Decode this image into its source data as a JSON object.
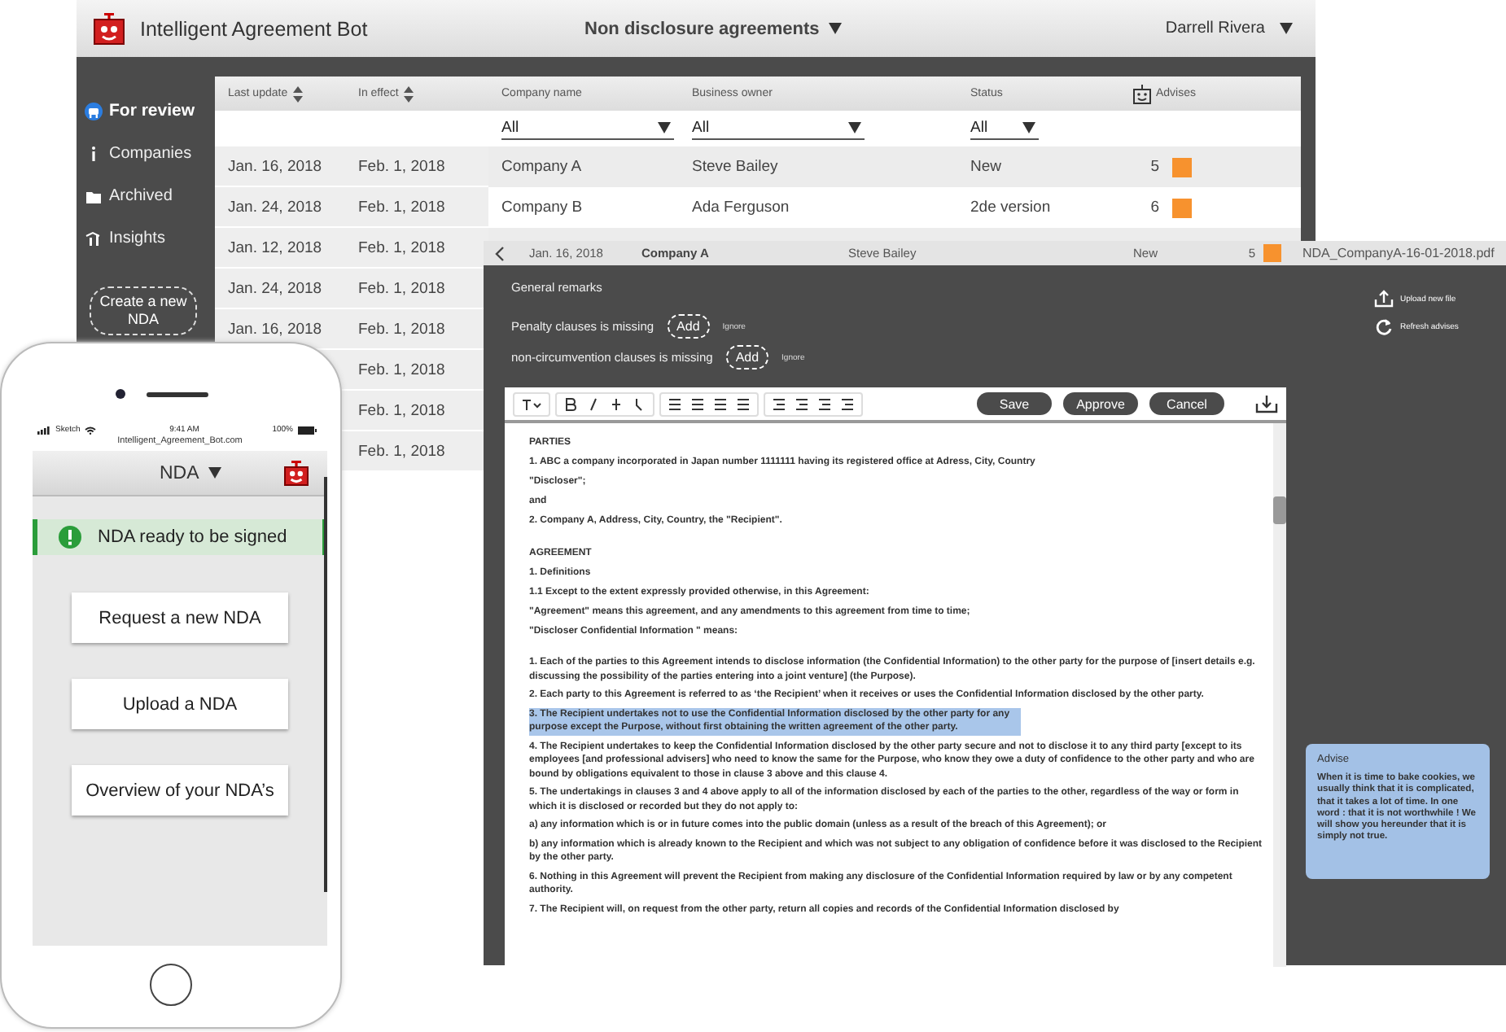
{
  "app": {
    "title": "Intelligent Agreement Bot",
    "section": "Non disclosure agreements",
    "user": "Darrell Rivera"
  },
  "sidebar": {
    "items": [
      {
        "label": "For review",
        "selected": true,
        "kind": "review"
      },
      {
        "label": "Companies",
        "selected": false,
        "kind": "companies"
      },
      {
        "label": "Archived",
        "selected": false,
        "kind": "archived"
      },
      {
        "label": "Insights",
        "selected": false,
        "kind": "insights"
      }
    ],
    "create_button": "Create a new NDA"
  },
  "table": {
    "columns": [
      {
        "label": "Last update",
        "sortable": true
      },
      {
        "label": "In effect",
        "sortable": true
      },
      {
        "label": "Company name",
        "sortable": false,
        "filter": "All"
      },
      {
        "label": "Business owner",
        "sortable": false,
        "filter": "All"
      },
      {
        "label": "Status",
        "sortable": false,
        "filter": "All"
      },
      {
        "label": "Advises",
        "sortable": false
      }
    ],
    "rows": [
      {
        "last_update": "Jan. 16, 2018",
        "in_effect": "Feb. 1, 2018",
        "company": "Company A",
        "owner": "Steve Bailey",
        "status": "New",
        "advises": "5"
      },
      {
        "last_update": "Jan. 24, 2018",
        "in_effect": "Feb. 1, 2018",
        "company": "Company B",
        "owner": "Ada Ferguson",
        "status": "2de version",
        "advises": "6"
      },
      {
        "last_update": "Jan. 12, 2018",
        "in_effect": "Feb. 1, 2018"
      },
      {
        "last_update": "Jan. 24, 2018",
        "in_effect": "Feb. 1, 2018"
      },
      {
        "last_update": "Jan. 16, 2018",
        "in_effect": "Feb. 1, 2018"
      },
      {
        "in_effect": "Feb. 1, 2018"
      },
      {
        "in_effect": "Feb. 1, 2018"
      },
      {
        "in_effect": "Feb. 1, 2018"
      }
    ]
  },
  "document": {
    "header": {
      "date": "Jan. 16, 2018",
      "company": "Company A",
      "owner": "Steve Bailey",
      "status": "New",
      "advises": "5",
      "file": "NDA_CompanyA-16-01-2018.pdf"
    },
    "remarks_title": "General remarks",
    "remarks": [
      {
        "text": "Penalty clauses is missing",
        "action": "Add",
        "dismiss": "Ignore"
      },
      {
        "text": "non-circumvention clauses is missing",
        "action": "Add",
        "dismiss": "Ignore"
      }
    ],
    "side_actions": [
      {
        "label": "Upload new file",
        "kind": "upload"
      },
      {
        "label": "Refresh advises",
        "kind": "refresh"
      }
    ],
    "buttons": [
      "Save",
      "Approve",
      "Cancel"
    ],
    "sections": [
      {
        "paragraphs": [
          {
            "text": "PARTIES",
            "highlighted": false
          },
          {
            "text": "1. ABC a company incorporated in Japan number 1111111 having its registered office at Adress, City, Country",
            "highlighted": false
          },
          {
            "text": "\"Discloser\";",
            "highlighted": false
          },
          {
            "text": "and",
            "highlighted": false
          },
          {
            "text": "2. Company A, Address, City, Country, the \"Recipient\".",
            "highlighted": false
          }
        ]
      },
      {
        "paragraphs": [
          {
            "text": "AGREEMENT",
            "highlighted": false
          },
          {
            "text": "1. Definitions",
            "highlighted": false
          },
          {
            "text": "1.1 Except to the extent expressly provided otherwise, in this Agreement:",
            "highlighted": false
          },
          {
            "text": "\"Agreement\" means this agreement, and any amendments to this agreement  from time to time;",
            "highlighted": false
          },
          {
            "text": "\"Discloser Confidential Information \" means:",
            "highlighted": false
          }
        ]
      },
      {
        "paragraphs": [
          {
            "text": "1. Each of the parties to this Agreement intends to disclose information (the Confidential Information) to the other party for the purpose of [insert details e.g. discussing the possibility of the parties entering into a joint venture] (the Purpose).",
            "highlighted": false
          },
          {
            "text": "2. Each party to this Agreement is referred to as ‘the Recipient’ when it receives or uses the Confidential Information disclosed by the other party.",
            "highlighted": false
          },
          {
            "text": "3. The Recipient undertakes not to use the Confidential Information disclosed by the other party for any purpose except the Purpose, without first obtaining the written agreement of the other party.",
            "highlighted": true
          },
          {
            "text": "4. The Recipient undertakes to keep the Confidential Information disclosed by the other party secure and not to disclose it to any third party [except to its employees [and professional advisers] who need to know the same for the Purpose, who know they owe a duty of confidence to the other party and who are bound by obligations equivalent to those in clause 3 above and this clause 4.",
            "highlighted": false
          },
          {
            "text": "5. The undertakings in clauses 3 and 4 above apply to all of the information disclosed by each of the parties to the other, regardless of the way or form in which it is disclosed or recorded but they do not apply to:",
            "highlighted": false
          },
          {
            "text": "a) any information which is or in future comes into the public domain (unless as a result of the breach of this Agreement); or",
            "highlighted": false
          },
          {
            "text": "b) any information which is already known to the Recipient and which was not subject to any obligation of confidence before it was disclosed to the Recipient by the other party.",
            "highlighted": false
          },
          {
            "text": "6. Nothing in this Agreement will prevent the Recipient from making any disclosure of the Confidential Information required by law or by any competent authority.",
            "highlighted": false
          },
          {
            "text": "7. The Recipient will, on request from the other party, return all copies and records of the Confidential Information disclosed by",
            "highlighted": false
          }
        ]
      }
    ],
    "advise": {
      "title": "Advise",
      "text": "When it is time to bake cookies, we usually think that it is complicated, that it takes a lot of time. In one word : that it is not worthwhile ! We will show you hereunder that it is simply not true."
    }
  },
  "phone": {
    "carrier": "Sketch",
    "time": "9:41 AM",
    "battery": "100%",
    "url": "Intelligent_Agreement_Bot.com",
    "nav_title": "NDA",
    "banner": "NDA ready to be signed",
    "buttons": [
      "Request a new NDA",
      "Upload a NDA",
      "Overview of your NDA’s"
    ]
  }
}
